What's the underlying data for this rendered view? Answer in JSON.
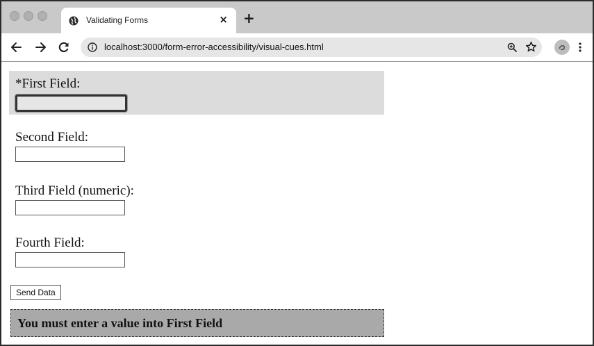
{
  "browser": {
    "tab": {
      "title": "Validating Forms",
      "close_glyph": "×",
      "favicon": "globe-icon"
    },
    "new_tab_glyph": "+",
    "nav": {
      "back_icon": "arrow-left-icon",
      "forward_icon": "arrow-right-icon",
      "reload_icon": "reload-icon"
    },
    "address_bar": {
      "url": "localhost:3000/form-error-accessibility/visual-cues.html",
      "info_icon": "info-icon"
    },
    "toolbar_icons": [
      "zoom-icon",
      "star-icon",
      "profile-icon",
      "menu-icon"
    ]
  },
  "form": {
    "fields": [
      {
        "label": "*First Field:",
        "value": "",
        "state": "error"
      },
      {
        "label": "Second Field:",
        "value": ""
      },
      {
        "label": "Third Field (numeric):",
        "value": ""
      },
      {
        "label": "Fourth Field:",
        "value": ""
      }
    ],
    "submit_label": "Send Data",
    "error_message": "You must enter a value into First Field"
  },
  "colors": {
    "error_group_bg": "#dcdcdc",
    "error_message_bg": "#a9a9a9",
    "tab_strip_bg": "#c9c9c9",
    "omnibox_bg": "#e6e6e6"
  }
}
